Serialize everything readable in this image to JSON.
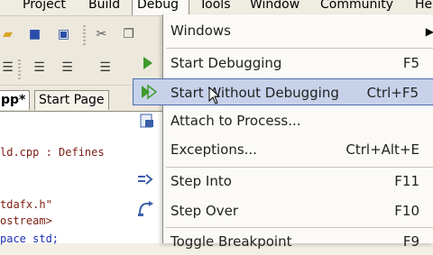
{
  "menubar": {
    "items": [
      "Project",
      "Build",
      "Debug",
      "Tools",
      "Window",
      "Community",
      "He"
    ]
  },
  "tabs": {
    "active": "pp*",
    "inactive": "Start Page"
  },
  "code": {
    "lines": [
      "ld.cpp : Defines",
      "tdafx.h\"",
      "ostream>",
      "pace std;"
    ]
  },
  "debug_menu": {
    "items": [
      {
        "label": "Windows",
        "shortcut": "",
        "icon": "",
        "submenu": true
      },
      {
        "label": "Start Debugging",
        "shortcut": "F5",
        "icon": "play-icon"
      },
      {
        "label": "Start Without Debugging",
        "shortcut": "Ctrl+F5",
        "icon": "run-icon",
        "highlighted": true
      },
      {
        "label": "Attach to Process...",
        "shortcut": "",
        "icon": "attach-icon"
      },
      {
        "label": "Exceptions...",
        "shortcut": "Ctrl+Alt+E",
        "icon": ""
      },
      {
        "label": "Step Into",
        "shortcut": "F11",
        "icon": "step-into-icon"
      },
      {
        "label": "Step Over",
        "shortcut": "F10",
        "icon": "step-over-icon"
      },
      {
        "label": "Toggle Breakpoint",
        "shortcut": "F9",
        "icon": ""
      }
    ]
  }
}
